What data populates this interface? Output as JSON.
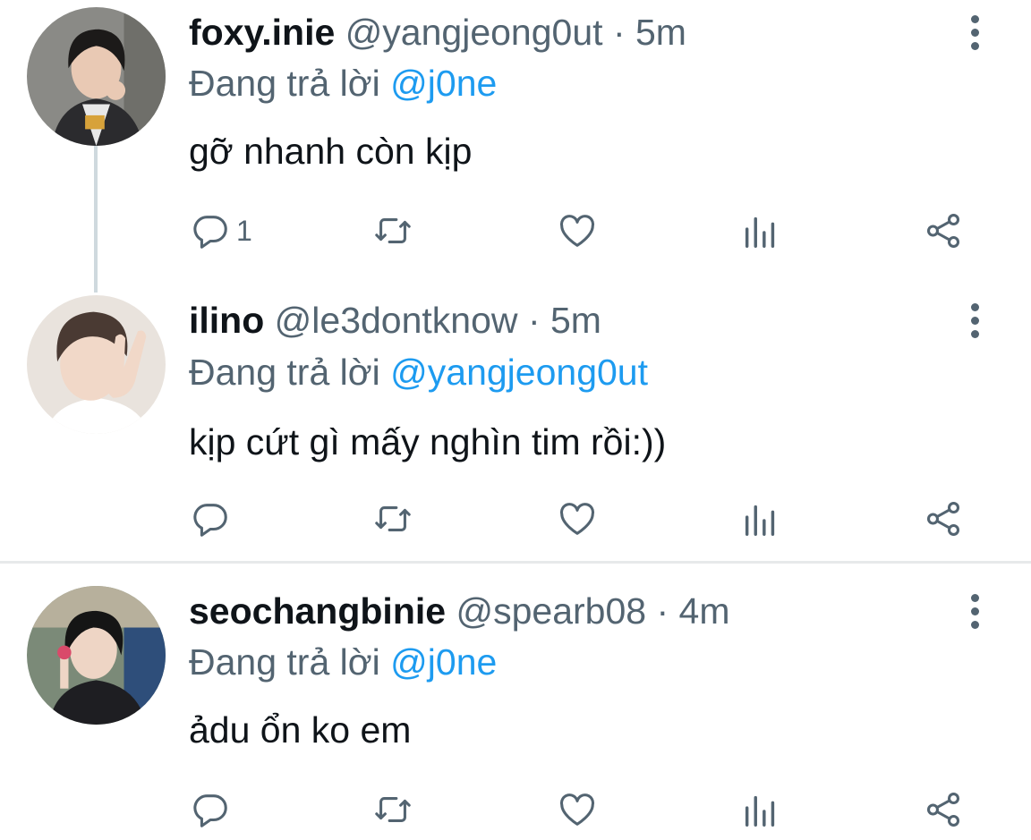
{
  "tweets": [
    {
      "name": "foxy.inie",
      "handle": "@yangjeong0ut",
      "dot": "·",
      "time": "5m",
      "reply_prefix": "Đang trả lời",
      "reply_to": "@j0ne",
      "text": "gỡ nhanh còn kịp",
      "reply_count": "1",
      "avatar_colors": {
        "bg": "#8a8a86",
        "hair": "#1c1a19",
        "skin": "#e9c9b4",
        "jacket": "#2b2b2e"
      }
    },
    {
      "name": "ilino",
      "handle": "@le3dontknow",
      "dot": "·",
      "time": "5m",
      "reply_prefix": "Đang trả lời",
      "reply_to": "@yangjeong0ut",
      "text": "kịp cứt gì mấy nghìn tim rồi:))",
      "reply_count": "",
      "avatar_colors": {
        "bg": "#e9e3dd",
        "hair": "#4a3a33",
        "skin": "#f1d8c8",
        "jacket": "#ffffff"
      }
    },
    {
      "name": "seochangbinie",
      "handle": "@spearb08",
      "dot": "·",
      "time": "4m",
      "reply_prefix": "Đang trả lời",
      "reply_to": "@j0ne",
      "text": "ảdu ổn ko em",
      "reply_count": "",
      "avatar_colors": {
        "bg": "#7b8a78",
        "hair": "#151515",
        "skin": "#eed5c5",
        "jacket": "#1e1e22"
      }
    }
  ],
  "icons": {
    "reply": "reply-icon",
    "retweet": "retweet-icon",
    "like": "heart-icon",
    "views": "analytics-icon",
    "share": "share-icon",
    "more": "more-vertical-icon"
  },
  "colors": {
    "link": "#1d9bf0",
    "secondary": "#536471",
    "icon": "#536471",
    "thread_line": "#cfd9de"
  }
}
